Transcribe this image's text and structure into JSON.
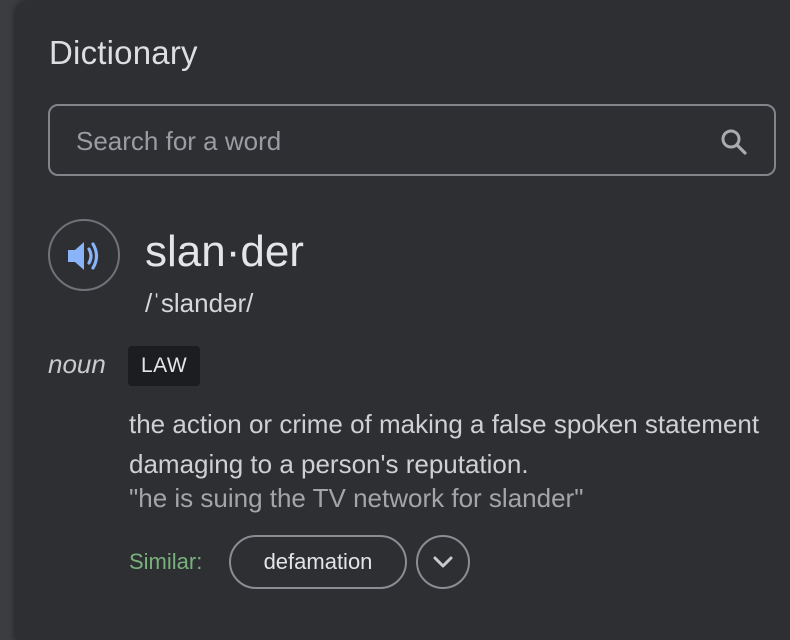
{
  "panel": {
    "title": "Dictionary"
  },
  "search": {
    "placeholder": "Search for a word",
    "value": ""
  },
  "entry": {
    "headword": "slan·der",
    "phonetic": "/ˈslandər/",
    "part_of_speech": "noun",
    "label": "LAW",
    "definition": "the action or crime of making a false spoken statement damaging to a person's reputation.",
    "example": "\"he is suing the TV network for slander\"",
    "similar_label": "Similar:",
    "similar_words": [
      "defamation"
    ]
  },
  "icons": {
    "search": "search-icon",
    "speaker": "speaker-icon",
    "expand": "chevron-down-icon"
  },
  "colors": {
    "panel_bg": "#2e2f33",
    "speaker_accent": "#8ab4f8",
    "similar_label": "#79b17d"
  }
}
